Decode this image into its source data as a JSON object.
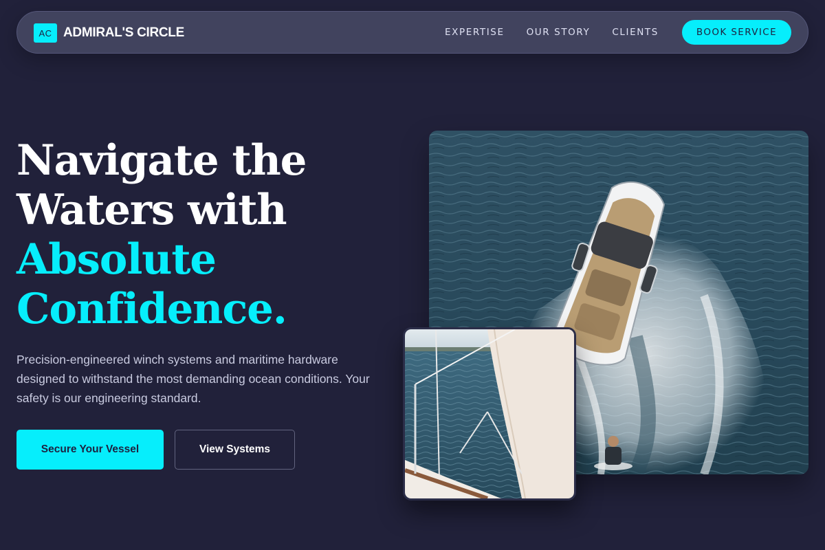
{
  "brand": {
    "badge": "AC",
    "name": "ADMIRAL'S CIRCLE"
  },
  "nav": {
    "links": [
      "EXPERTISE",
      "OUR STORY",
      "CLIENTS"
    ],
    "cta": "BOOK SERVICE"
  },
  "hero": {
    "title_lines": [
      "Navigate the",
      "Waters with"
    ],
    "title_accent_lines": [
      "Absolute",
      "Confidence."
    ],
    "subtitle": "Precision-engineered winch systems and maritime hardware designed to withstand the most demanding ocean conditions. Your safety is our engineering standard.",
    "primary_button": "Secure Your Vessel",
    "secondary_button": "View Systems"
  },
  "colors": {
    "background": "#21213a",
    "accent": "#06eefc",
    "nav_background": "#41435e"
  },
  "images": {
    "main": "speedboat-aerial-photo",
    "secondary": "sailboat-rigging-photo"
  }
}
